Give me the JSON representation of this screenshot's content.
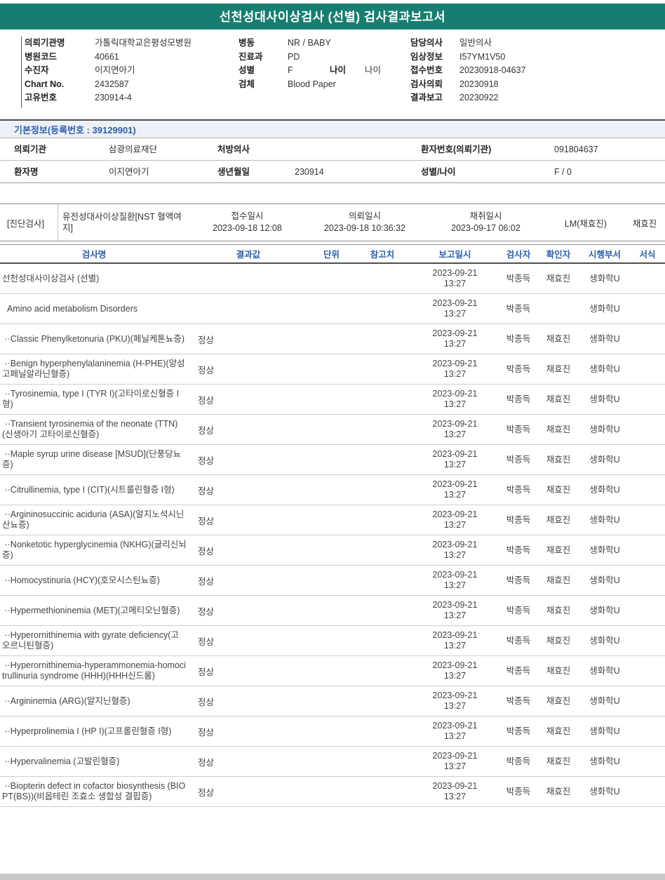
{
  "colors": {
    "accent_teal": "#177d70",
    "header_blue": "#2d5fa8",
    "basic_bar_bg": "#edf1f7"
  },
  "page": {
    "title": "선천성대사이상검사 (선별) 검사결과보고서"
  },
  "patient_header": {
    "col1": [
      {
        "label": "의뢰기관명",
        "value": "가톨릭대학교은평성모병원"
      },
      {
        "label": "병원코드",
        "value": "40661"
      },
      {
        "label": "수진자",
        "value": "이지연아기"
      },
      {
        "label": "Chart No.",
        "value": "2432587"
      },
      {
        "label": "고유번호",
        "value": "230914-4"
      }
    ],
    "col2": [
      {
        "label": "병동",
        "value": "NR / BABY"
      },
      {
        "label": "진료과",
        "value": "PD"
      },
      {
        "label": "성별",
        "value": "F"
      },
      {
        "label": "검체",
        "value": "Blood Paper"
      }
    ],
    "col2_extra": {
      "label": "나이",
      "value": "나이"
    },
    "col3": [
      {
        "label": "담당의사",
        "value": "일반의사"
      },
      {
        "label": "임상정보",
        "value": "I57YM1V50"
      },
      {
        "label": "접수번호",
        "value": "20230918-04637"
      },
      {
        "label": "검사의뢰",
        "value": "20230918"
      },
      {
        "label": "결과보고",
        "value": "20230922"
      }
    ]
  },
  "basic_info": {
    "header": "기본정보(등록번호 : 39129901)",
    "row1": {
      "l1": "의뢰기관",
      "v1": "삼광의료재단",
      "l2": "처방의사",
      "v2": "",
      "l3": "환자번호(의뢰기관)",
      "v3": "091804637"
    },
    "row2": {
      "l1": "환자명",
      "v1": "이지연아기",
      "l2": "생년월일",
      "v2": "230914",
      "l3": "성별/나이",
      "v3": "F / 0"
    }
  },
  "diagnosis": {
    "tag": "[진단검사]",
    "test_name": "유전성대사이상질환[NST 혈액여지]",
    "receipt_label": "접수일시",
    "receipt_time": "2023-09-18 12:08",
    "request_label": "의뢰일시",
    "request_time": "2023-09-18 10:36:32",
    "collection_label": "채취일시",
    "collection_time": "2023-09-17 06:02",
    "collector": "LM(채효진)",
    "verifier": "채효진"
  },
  "results": {
    "columns": [
      "검사명",
      "결과값",
      "단위",
      "참고치",
      "보고일시",
      "검사자",
      "확인자",
      "시행부서",
      "서식"
    ],
    "rows": [
      {
        "name": "선천성대사이상검사 (선별)",
        "result": "",
        "unit": "",
        "ref": "",
        "report_date": "2023-09-21",
        "report_time": "13:27",
        "tester": "박종득",
        "confirmer": "채효진",
        "dept": "생화학U",
        "format": ""
      },
      {
        "name": "  Amino acid metabolism Disorders",
        "result": "",
        "unit": "",
        "ref": "",
        "report_date": "2023-09-21",
        "report_time": "13:27",
        "tester": "박종득",
        "confirmer": "",
        "dept": "생화학U",
        "format": ""
      },
      {
        "name": " ··Classic Phenylketonuria (PKU)(페닐케톤뇨증)",
        "result": "정상",
        "unit": "",
        "ref": "",
        "report_date": "2023-09-21",
        "report_time": "13:27",
        "tester": "박종득",
        "confirmer": "채효진",
        "dept": "생화학U",
        "format": ""
      },
      {
        "name": " ··Benign hyperphenylalaninemia (H-PHE)(양성 고페닐알라닌혈증)",
        "result": "정상",
        "unit": "",
        "ref": "",
        "report_date": "2023-09-21",
        "report_time": "13:27",
        "tester": "박종득",
        "confirmer": "채효진",
        "dept": "생화학U",
        "format": ""
      },
      {
        "name": " ··Tyrosinemia, type I (TYR I)(고타이로신혈증 I형)",
        "result": "정상",
        "unit": "",
        "ref": "",
        "report_date": "2023-09-21",
        "report_time": "13:27",
        "tester": "박종득",
        "confirmer": "채효진",
        "dept": "생화학U",
        "format": ""
      },
      {
        "name": " ··Transient tyrosinemia of the neonate (TTN)(신생아기 고타이로신혈증)",
        "result": "정상",
        "unit": "",
        "ref": "",
        "report_date": "2023-09-21",
        "report_time": "13:27",
        "tester": "박종득",
        "confirmer": "채효진",
        "dept": "생화학U",
        "format": ""
      },
      {
        "name": " ··Maple syrup urine disease [MSUD](단풍당뇨증)",
        "result": "정상",
        "unit": "",
        "ref": "",
        "report_date": "2023-09-21",
        "report_time": "13:27",
        "tester": "박종득",
        "confirmer": "채효진",
        "dept": "생화학U",
        "format": ""
      },
      {
        "name": " ··Citrullinemia, type I (CIT)(시트룰린혈증 I형)",
        "result": "정상",
        "unit": "",
        "ref": "",
        "report_date": "2023-09-21",
        "report_time": "13:27",
        "tester": "박종득",
        "confirmer": "채효진",
        "dept": "생화학U",
        "format": ""
      },
      {
        "name": " ··Argininosuccinic aciduria (ASA)(알지노석시닌산뇨증)",
        "result": "정상",
        "unit": "",
        "ref": "",
        "report_date": "2023-09-21",
        "report_time": "13:27",
        "tester": "박종득",
        "confirmer": "채효진",
        "dept": "생화학U",
        "format": ""
      },
      {
        "name": " ··Nonketotic hyperglycinemia (NKHG)(글리신뇌증)",
        "result": "정상",
        "unit": "",
        "ref": "",
        "report_date": "2023-09-21",
        "report_time": "13:27",
        "tester": "박종득",
        "confirmer": "채효진",
        "dept": "생화학U",
        "format": ""
      },
      {
        "name": " ··Homocystinuria (HCY)(호모시스틴뇨증)",
        "result": "정상",
        "unit": "",
        "ref": "",
        "report_date": "2023-09-21",
        "report_time": "13:27",
        "tester": "박종득",
        "confirmer": "채효진",
        "dept": "생화학U",
        "format": ""
      },
      {
        "name": " ··Hypermethioninemia (MET)(고메티오닌혈증)",
        "result": "정상",
        "unit": "",
        "ref": "",
        "report_date": "2023-09-21",
        "report_time": "13:27",
        "tester": "박종득",
        "confirmer": "채효진",
        "dept": "생화학U",
        "format": ""
      },
      {
        "name": " ··Hyperornithinemia with gyrate deficiency(고오르니틴혈증)",
        "result": "정상",
        "unit": "",
        "ref": "",
        "report_date": "2023-09-21",
        "report_time": "13:27",
        "tester": "박종득",
        "confirmer": "채효진",
        "dept": "생화학U",
        "format": ""
      },
      {
        "name": " ··Hyperornithinemia-hyperammonemia-homocitrullinuria syndrome (HHH)(HHH신드롬)",
        "result": "정상",
        "unit": "",
        "ref": "",
        "report_date": "2023-09-21",
        "report_time": "13:27",
        "tester": "박종득",
        "confirmer": "채효진",
        "dept": "생화학U",
        "format": ""
      },
      {
        "name": " ··Argininemia (ARG)(알지닌혈증)",
        "result": "정상",
        "unit": "",
        "ref": "",
        "report_date": "2023-09-21",
        "report_time": "13:27",
        "tester": "박종득",
        "confirmer": "채효진",
        "dept": "생화학U",
        "format": ""
      },
      {
        "name": " ··Hyperprolinemia I (HP I)(고프롤린혈증 I형)",
        "result": "정상",
        "unit": "",
        "ref": "",
        "report_date": "2023-09-21",
        "report_time": "13:27",
        "tester": "박종득",
        "confirmer": "채효진",
        "dept": "생화학U",
        "format": ""
      },
      {
        "name": " ··Hypervalinemia (고발린혈증)",
        "result": "정상",
        "unit": "",
        "ref": "",
        "report_date": "2023-09-21",
        "report_time": "13:27",
        "tester": "박종득",
        "confirmer": "채효진",
        "dept": "생화학U",
        "format": ""
      },
      {
        "name": " ··Biopterin defect in cofactor biosynthesis (BIOPT(BS))(비옵테린 조효소 생합성 결핍증)",
        "result": "정상",
        "unit": "",
        "ref": "",
        "report_date": "2023-09-21",
        "report_time": "13:27",
        "tester": "박종득",
        "confirmer": "채효진",
        "dept": "생화학U",
        "format": ""
      }
    ]
  }
}
